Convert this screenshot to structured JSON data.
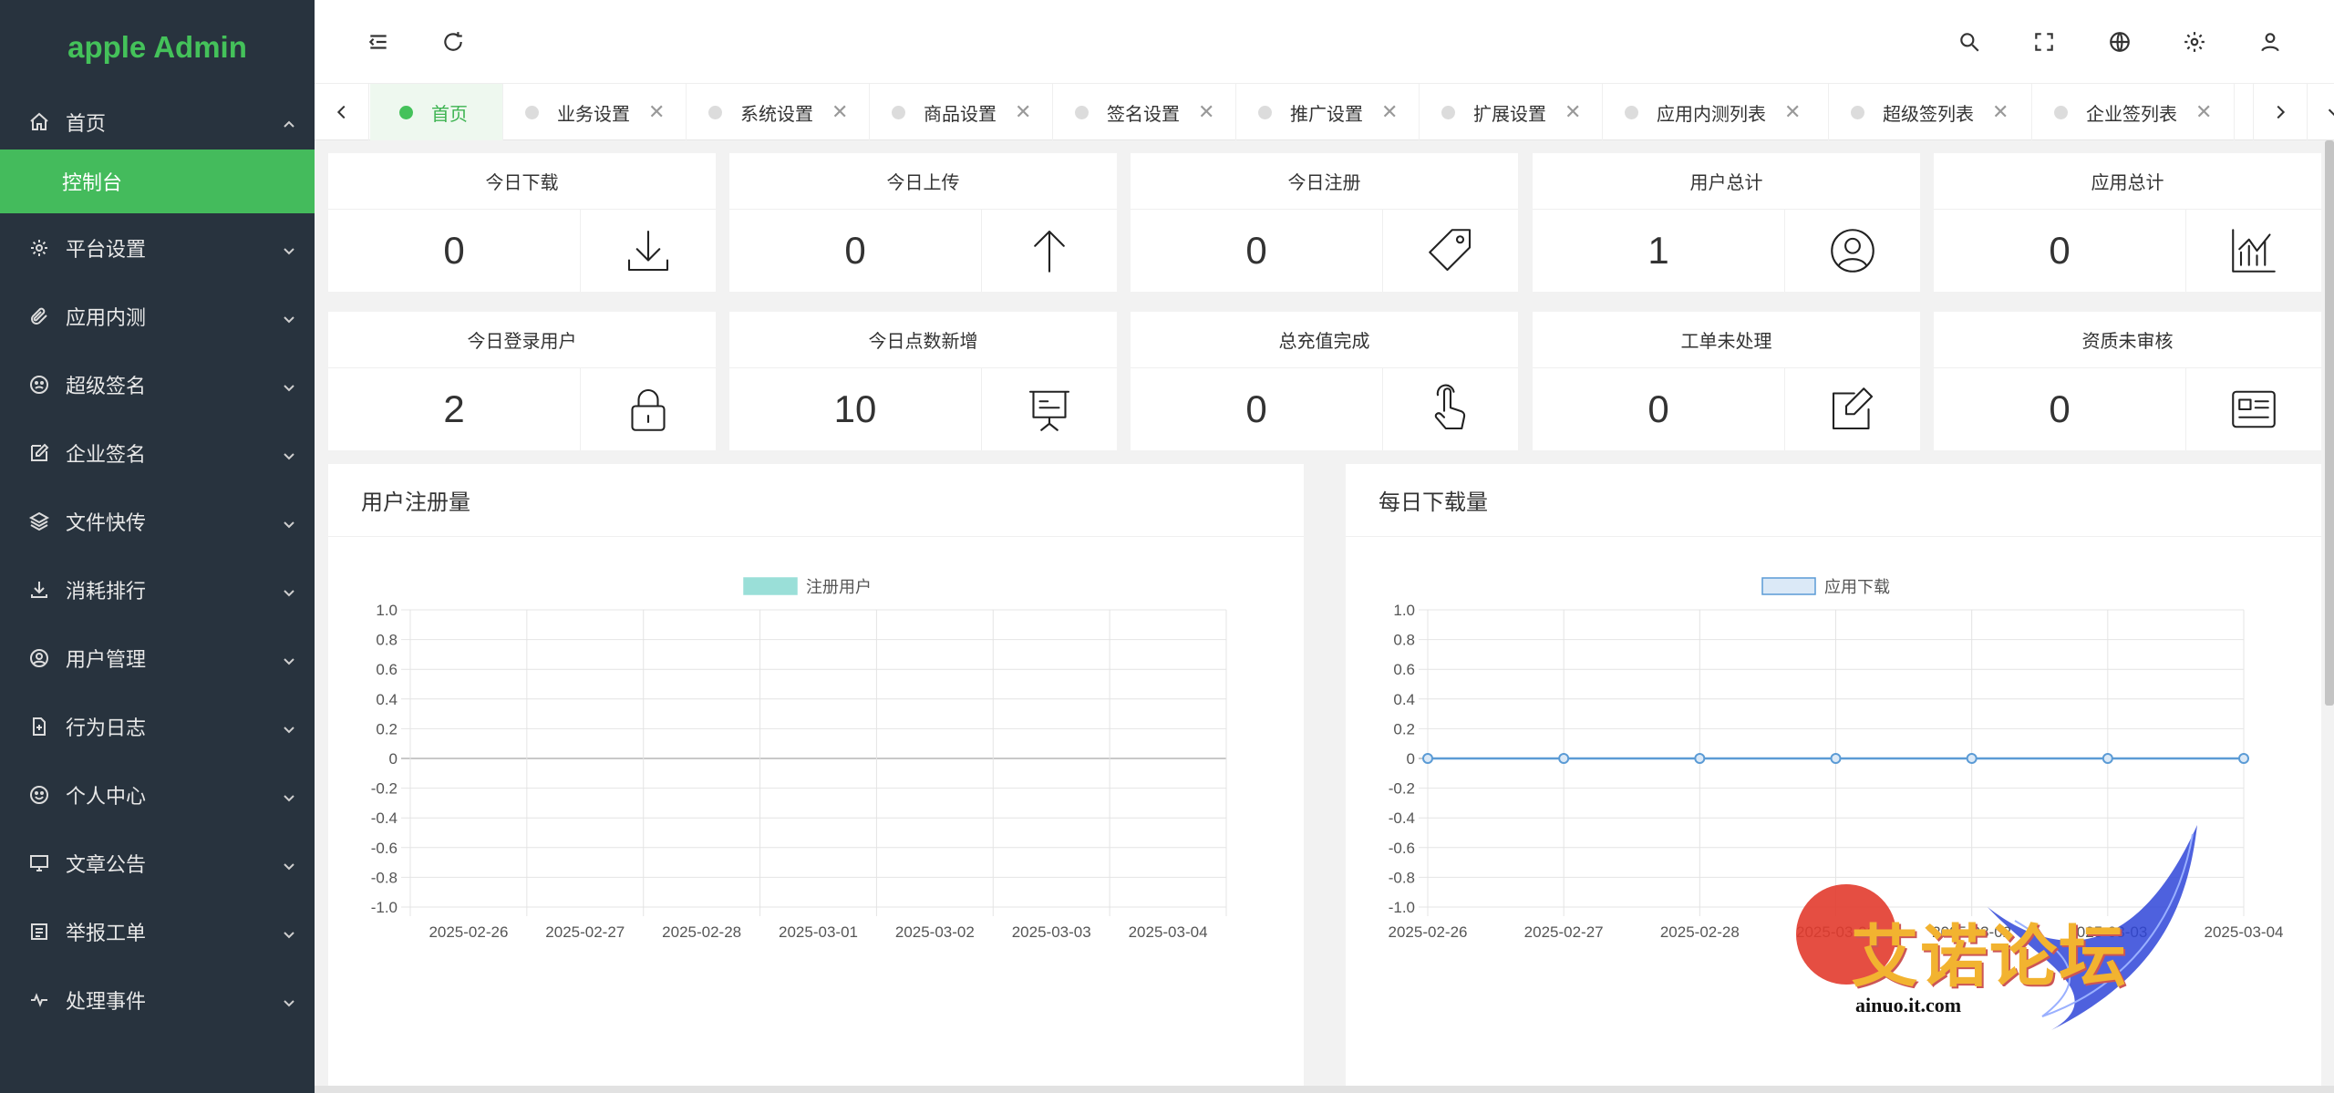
{
  "app": {
    "title": "apple Admin"
  },
  "sidebar": {
    "home": {
      "label": "首页",
      "icon": "home-icon"
    },
    "home_sub": "控制台",
    "items": [
      {
        "label": "平台设置",
        "icon": "gear-icon"
      },
      {
        "label": "应用内测",
        "icon": "paperclip-icon"
      },
      {
        "label": "超级签名",
        "icon": "face-icon"
      },
      {
        "label": "企业签名",
        "icon": "edit-icon"
      },
      {
        "label": "文件快传",
        "icon": "layers-icon"
      },
      {
        "label": "消耗排行",
        "icon": "download-icon"
      },
      {
        "label": "用户管理",
        "icon": "user-circle-icon"
      },
      {
        "label": "行为日志",
        "icon": "file-icon"
      },
      {
        "label": "个人中心",
        "icon": "smile-icon"
      },
      {
        "label": "文章公告",
        "icon": "monitor-icon"
      },
      {
        "label": "举报工单",
        "icon": "list-icon"
      },
      {
        "label": "处理事件",
        "icon": "pulse-icon"
      }
    ]
  },
  "tabs": [
    {
      "label": "首页",
      "active": true,
      "closable": false
    },
    {
      "label": "业务设置",
      "active": false,
      "closable": true
    },
    {
      "label": "系统设置",
      "active": false,
      "closable": true
    },
    {
      "label": "商品设置",
      "active": false,
      "closable": true
    },
    {
      "label": "签名设置",
      "active": false,
      "closable": true
    },
    {
      "label": "推广设置",
      "active": false,
      "closable": true
    },
    {
      "label": "扩展设置",
      "active": false,
      "closable": true
    },
    {
      "label": "应用内测列表",
      "active": false,
      "closable": true
    },
    {
      "label": "超级签列表",
      "active": false,
      "closable": true
    },
    {
      "label": "企业签列表",
      "active": false,
      "closable": true
    }
  ],
  "stats": [
    {
      "title": "今日下载",
      "value": "0",
      "icon": "download-icon"
    },
    {
      "title": "今日上传",
      "value": "0",
      "icon": "arrow-up-icon"
    },
    {
      "title": "今日注册",
      "value": "0",
      "icon": "tag-icon"
    },
    {
      "title": "用户总计",
      "value": "1",
      "icon": "user-circle-icon"
    },
    {
      "title": "应用总计",
      "value": "0",
      "icon": "chart-icon"
    },
    {
      "title": "今日登录用户",
      "value": "2",
      "icon": "lock-icon"
    },
    {
      "title": "今日点数新增",
      "value": "10",
      "icon": "presentation-icon"
    },
    {
      "title": "总充值完成",
      "value": "0",
      "icon": "hand-pointer-icon"
    },
    {
      "title": "工单未处理",
      "value": "0",
      "icon": "edit-icon"
    },
    {
      "title": "资质未审核",
      "value": "0",
      "icon": "id-card-icon"
    }
  ],
  "panels": {
    "left_title": "用户注册量",
    "right_title": "每日下载量"
  },
  "watermark": {
    "text": "艾诺论坛",
    "url": "ainuo.it.com"
  },
  "colors": {
    "brand": "#44c25a",
    "sidebar_bg": "#28333e",
    "active_menu": "#44bb5c",
    "reg_legend": "#9adfd8",
    "dl_line": "#5b9bd5"
  },
  "chart_data": [
    {
      "type": "bar",
      "title": "用户注册量",
      "categories": [
        "2025-02-26",
        "2025-02-27",
        "2025-02-28",
        "2025-03-01",
        "2025-03-02",
        "2025-03-03",
        "2025-03-04"
      ],
      "series": [
        {
          "name": "注册用户",
          "values": [
            0,
            0,
            0,
            0,
            0,
            0,
            0
          ]
        }
      ],
      "yticks": [
        "1.0",
        "0.8",
        "0.6",
        "0.4",
        "0.2",
        "0",
        "-0.2",
        "-0.4",
        "-0.6",
        "-0.8",
        "-1.0"
      ],
      "ylim": [
        -1.0,
        1.0
      ],
      "legend": "top-center",
      "grid": true
    },
    {
      "type": "line",
      "title": "每日下载量",
      "categories": [
        "2025-02-26",
        "2025-02-27",
        "2025-02-28",
        "2025-03-01",
        "2025-03-02",
        "2025-03-03",
        "2025-03-04"
      ],
      "series": [
        {
          "name": "应用下载",
          "values": [
            0,
            0,
            0,
            0,
            0,
            0,
            0
          ]
        }
      ],
      "yticks": [
        "1.0",
        "0.8",
        "0.6",
        "0.4",
        "0.2",
        "0",
        "-0.2",
        "-0.4",
        "-0.6",
        "-0.8",
        "-1.0"
      ],
      "ylim": [
        -1.0,
        1.0
      ],
      "legend": "top-center",
      "grid": true
    }
  ]
}
